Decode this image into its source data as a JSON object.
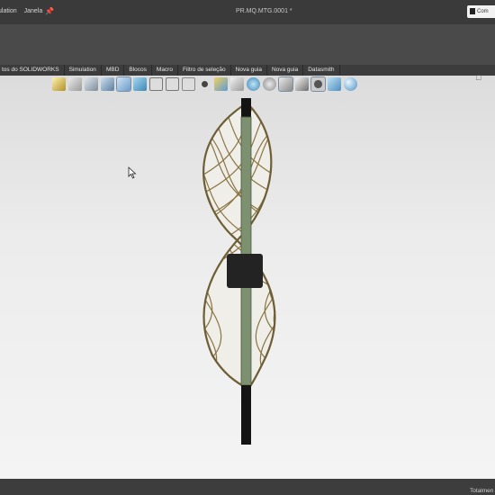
{
  "titlebar": {
    "menu": [
      "ulation",
      "Janela"
    ],
    "document_title": "PR.MQ.MTG.0001 *",
    "command_search": "Com"
  },
  "command_tabs": [
    "tos do SOLIDWORKS",
    "Simulation",
    "MBD",
    "Blocos",
    "Macro",
    "Filtro de seleção",
    "Nova guia",
    "Nova guia",
    "Datasmith"
  ],
  "status": {
    "text": "Totalmen"
  },
  "colors": {
    "titlebar": "#3a3a3a",
    "toolbar": "#4a4a4a",
    "viewport_top": "#dcdcdc",
    "viewport_bottom": "#f4f4f4",
    "lattice": "#8a7543",
    "post": "#7d9070",
    "post_ends": "#141414"
  },
  "icons": {
    "toolbar": [
      "sketch-icon",
      "clip-icon",
      "hatch-icon",
      "smart-dimension-icon",
      "relations-icon",
      "extrude-icon",
      "revolve-icon",
      "rib-icon",
      "mirror-icon",
      "assembly-icon",
      "pattern-icon",
      "measure-icon",
      "warning-icon",
      "camera-icon",
      "render-icon"
    ],
    "heads_up": [
      "zoom-fit-icon",
      "zoom-area-icon",
      "previous-view-icon",
      "section-view-icon",
      "view-orientation-icon",
      "shaded-icon",
      "wireframe-icon",
      "hidden-lines-icon",
      "edges-icon",
      "hide-show-icon",
      "appearance-icon",
      "scene-icon",
      "display-icon",
      "realview-icon",
      "shadows-icon",
      "ambient-occlusion-icon",
      "perspective-icon",
      "cartoon-icon"
    ]
  }
}
